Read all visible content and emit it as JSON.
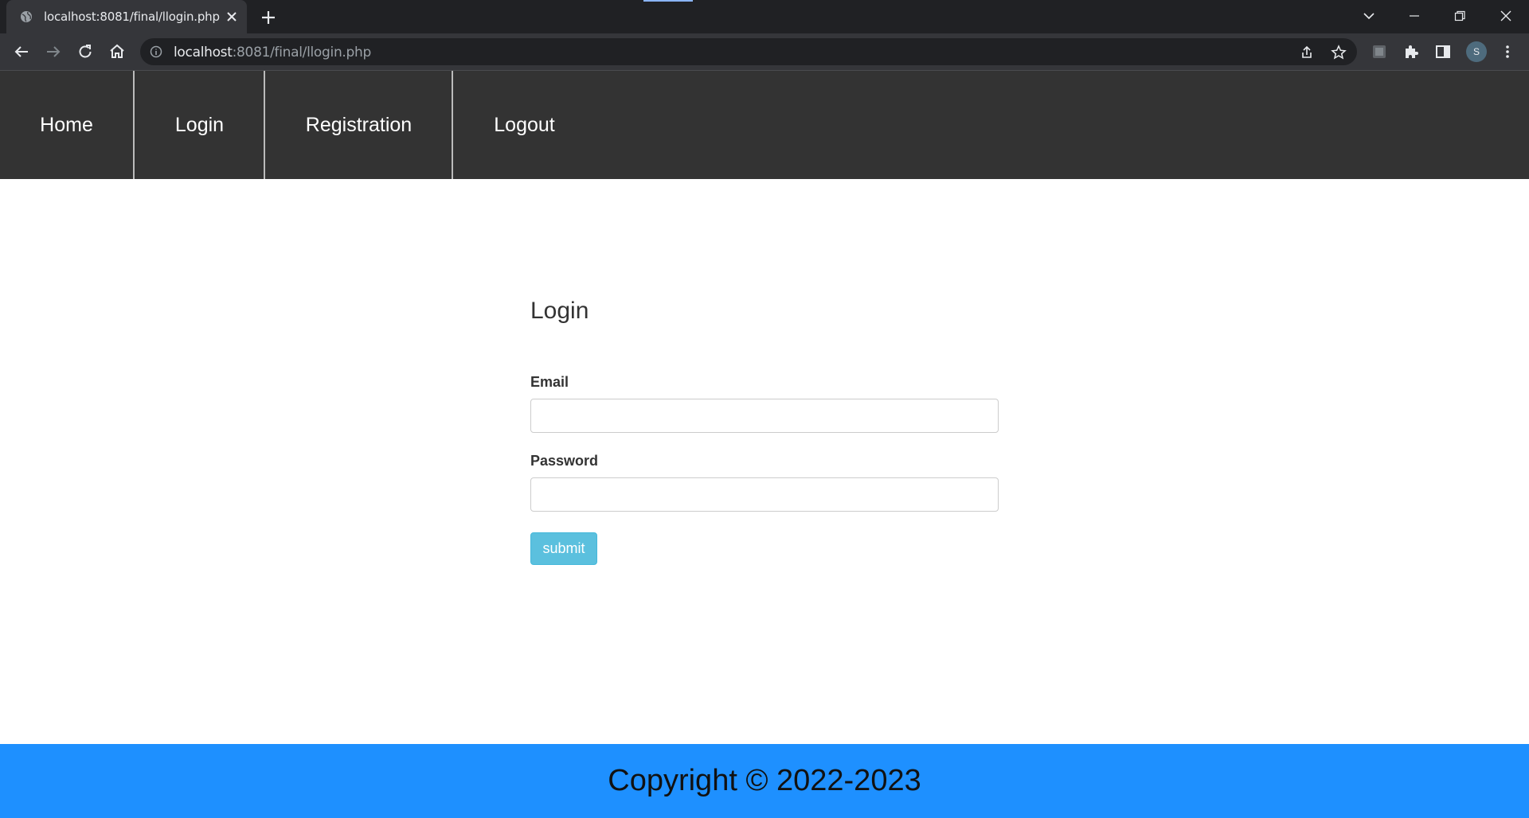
{
  "browser": {
    "tab_title": "localhost:8081/final/llogin.php",
    "url_host": "localhost",
    "url_rest": ":8081/final/llogin.php",
    "profile_initial": "S"
  },
  "nav": {
    "items": [
      {
        "label": "Home"
      },
      {
        "label": "Login"
      },
      {
        "label": "Registration"
      },
      {
        "label": "Logout"
      }
    ]
  },
  "login": {
    "title": "Login",
    "email_label": "Email",
    "email_value": "",
    "password_label": "Password",
    "password_value": "",
    "submit_label": "submit"
  },
  "footer": {
    "text": "Copyright © 2022-2023"
  },
  "colors": {
    "navbar_bg": "#333333",
    "footer_bg": "#1e90ff",
    "submit_bg": "#5bc0de"
  }
}
